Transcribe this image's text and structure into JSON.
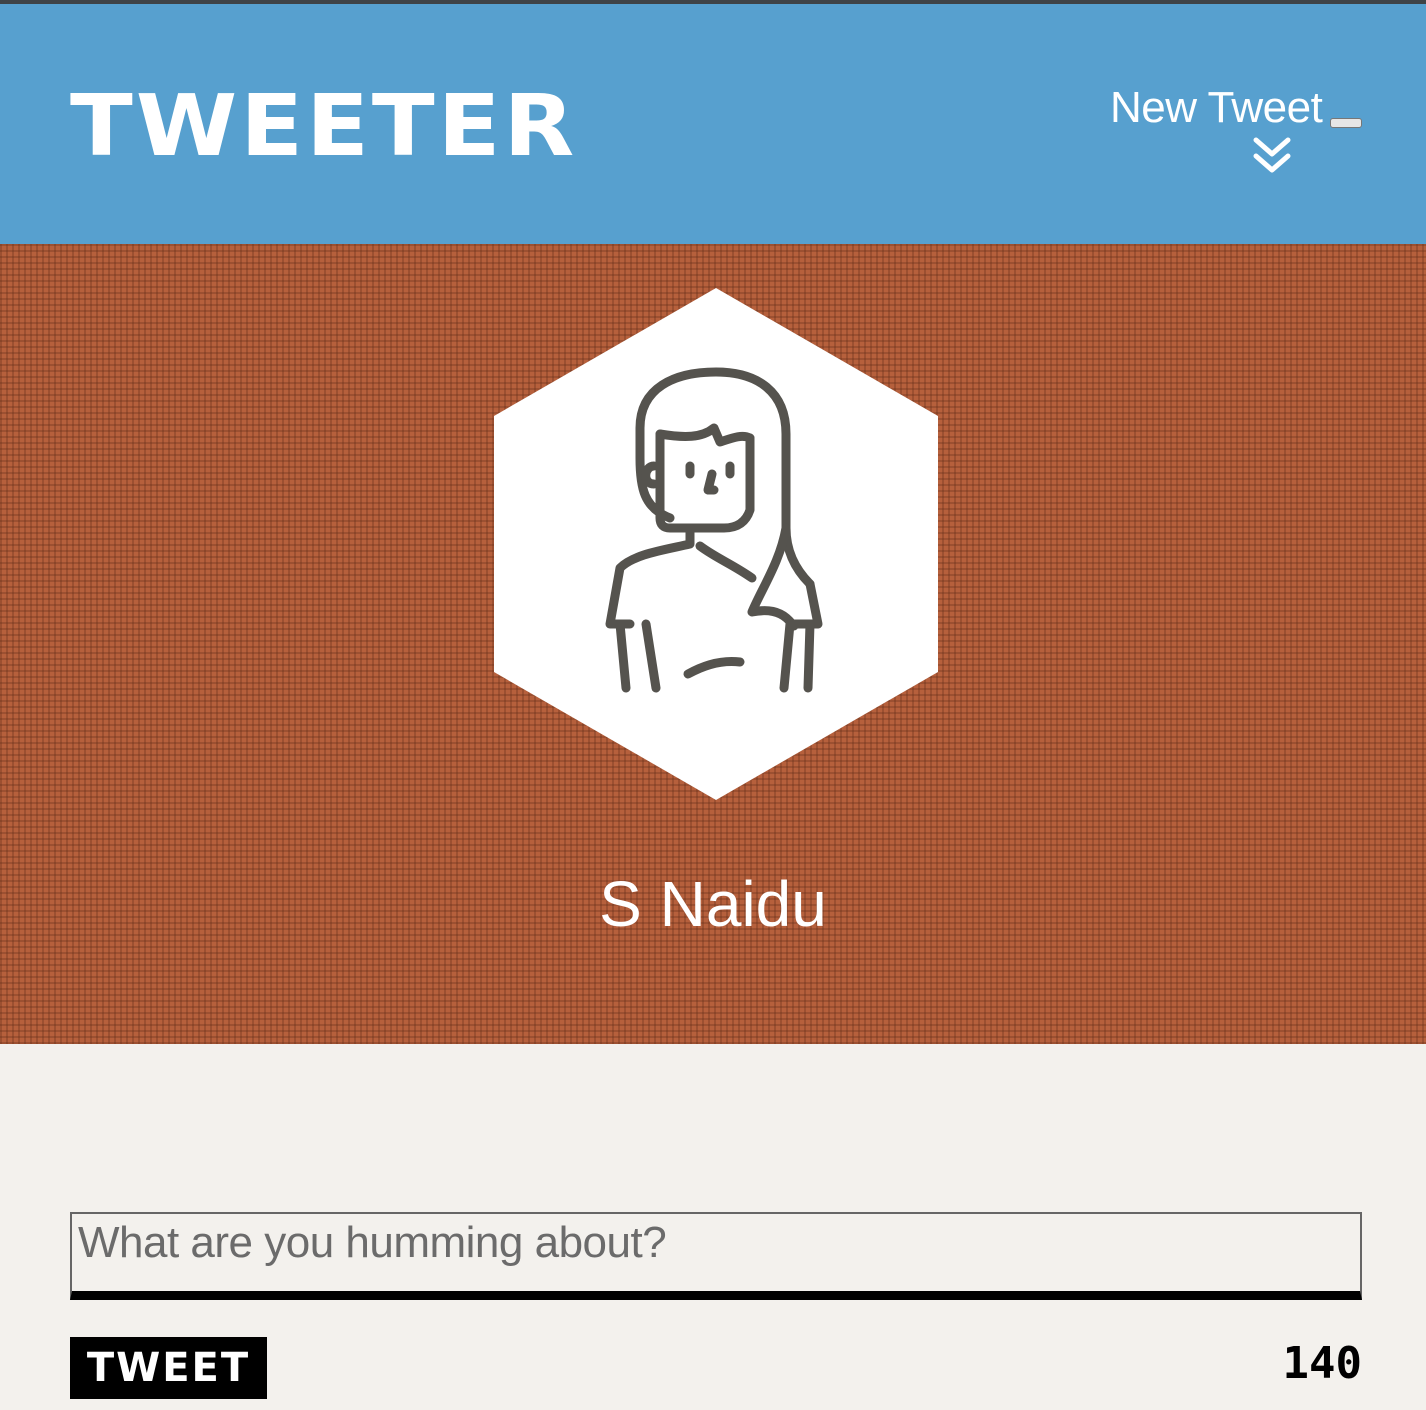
{
  "header": {
    "brand": "TWEETER",
    "new_tweet_label": "New Tweet",
    "toggle_icon": "chevron-double-down-icon",
    "background_color": "#57a0cf"
  },
  "profile": {
    "avatar_icon": "woman-avatar-icon",
    "name": "S Naidu",
    "background_color": "#b6603c"
  },
  "composer": {
    "placeholder": "What are you humming about?",
    "value": "",
    "submit_label": "TWEET",
    "char_count": "140"
  }
}
